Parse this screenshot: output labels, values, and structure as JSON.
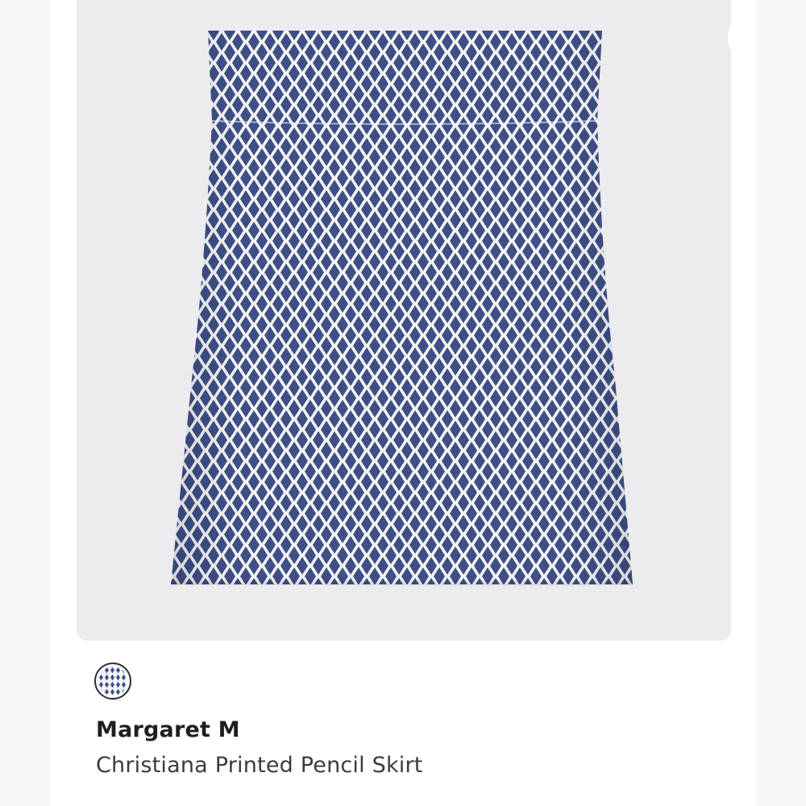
{
  "product": {
    "brand": "Margaret M",
    "name": "Christiana Printed Pencil Skirt",
    "image_icon": "skirt-photo",
    "more_icon": "more-horizontal-icon",
    "swatch_icon": "color-swatch-diamond-print"
  },
  "colors": {
    "card_background": "#ececef",
    "skirt_navy": "#3d4f86",
    "skirt_white": "#f4f4f6",
    "text_primary": "#1e1f24",
    "text_secondary": "#3a3b42"
  }
}
